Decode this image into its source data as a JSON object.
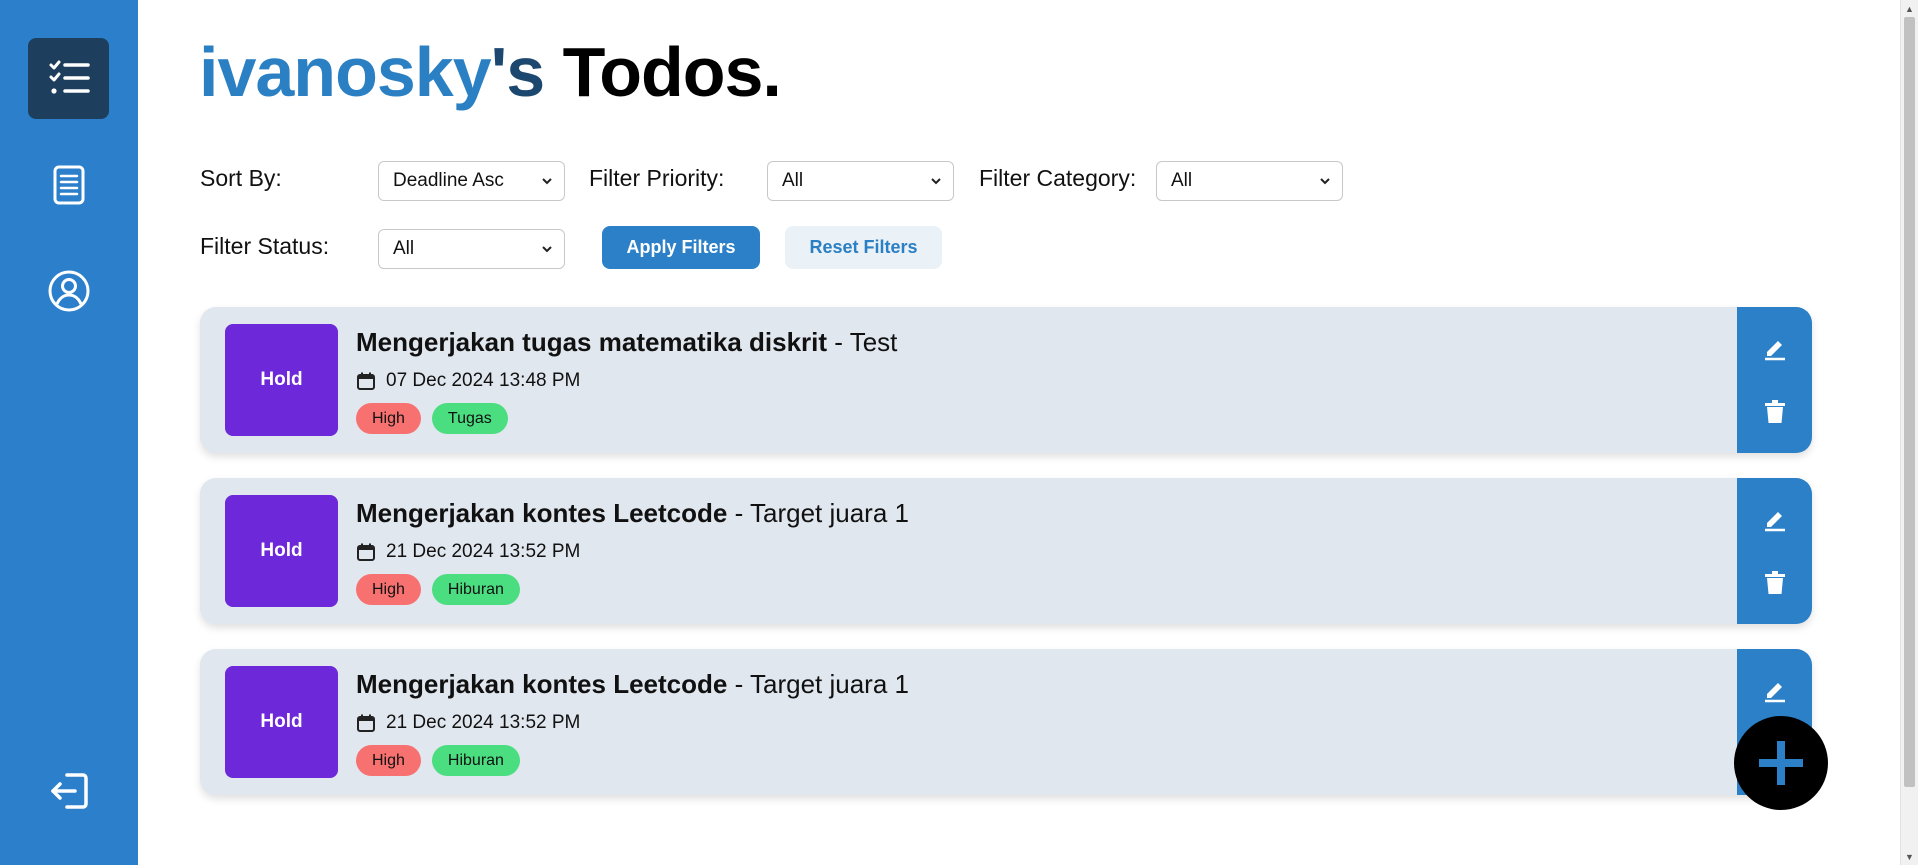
{
  "title": {
    "user": "ivanosky",
    "suffix": "'s",
    "todos": "Todos."
  },
  "sidebar": {
    "items": [
      {
        "icon": "todo-list-icon",
        "active": true
      },
      {
        "icon": "document-icon",
        "active": false
      },
      {
        "icon": "user-profile-icon",
        "active": false
      },
      {
        "icon": "logout-icon",
        "active": false
      }
    ]
  },
  "filters": {
    "sort_label": "Sort By:",
    "sort_value": "Deadline Asc",
    "priority_label": "Filter Priority:",
    "priority_value": "All",
    "category_label": "Filter Category:",
    "category_value": "All",
    "status_label": "Filter Status:",
    "status_value": "All",
    "apply_label": "Apply Filters",
    "reset_label": "Reset Filters"
  },
  "todos": [
    {
      "status": "Hold",
      "name": "Mengerjakan tugas matematika diskrit",
      "sep": " - ",
      "desc": "Test",
      "date": "07 Dec 2024 13:48 PM",
      "priority": "High",
      "category": "Tugas"
    },
    {
      "status": "Hold",
      "name": "Mengerjakan kontes Leetcode",
      "sep": " - ",
      "desc": "Target juara 1",
      "date": "21 Dec 2024 13:52 PM",
      "priority": "High",
      "category": "Hiburan"
    },
    {
      "status": "Hold",
      "name": "Mengerjakan kontes Leetcode",
      "sep": " - ",
      "desc": "Target juara 1",
      "date": "21 Dec 2024 13:52 PM",
      "priority": "High",
      "category": "Hiburan"
    }
  ],
  "colors": {
    "sidebar": "#2b7fcb",
    "sidebar_active": "#1d3e5c",
    "accent": "#2b80c8",
    "status_hold": "#6d28d9",
    "priority_high": "#f87171",
    "category_tag": "#4ade80",
    "card_bg": "#e1e7ef"
  }
}
